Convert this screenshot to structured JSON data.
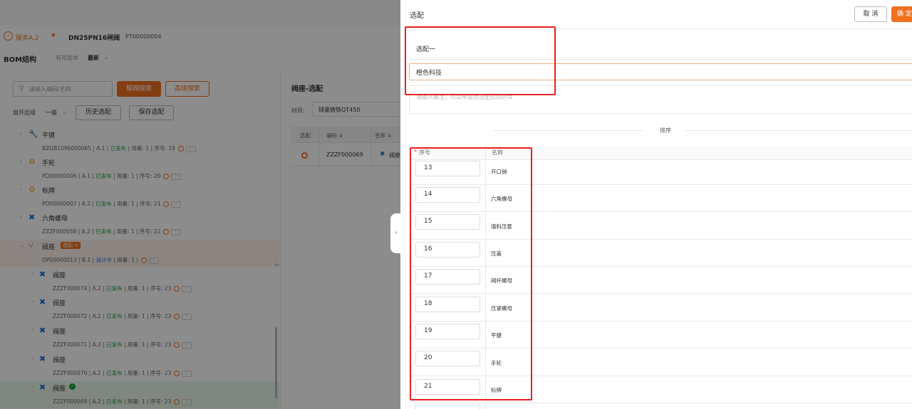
{
  "header": {
    "version_tag": "版本A.2",
    "part_name": "DN25PN16闸阀",
    "part_code": "PT00000004",
    "bom_title": "BOM结构",
    "effective_label": "有效版本",
    "effective_value": "最新"
  },
  "left_panel": {
    "search_placeholder": "请输入编码/名称",
    "fuzzy_search": "模糊搜索",
    "advanced_search": "高级搜索",
    "expand_label": "展开层级",
    "expand_value": "一级",
    "history_select": "历史选配",
    "save_select": "保存选配",
    "tree": [
      {
        "name": "平键",
        "meta_a": "BZGB1096000065 | A.1 |",
        "status": "已发布",
        "meta_b": "| 用量: 1 | 序号: 19",
        "icon": "wrench-icon"
      },
      {
        "name": "手轮",
        "meta_a": "PD00000006 | A.1 |",
        "status": "已发布",
        "meta_b": "| 用量: 1 | 序号: 20",
        "icon": "gear-icon"
      },
      {
        "name": "标牌",
        "meta_a": "PD00000007 | A.2 |",
        "status": "已发布",
        "meta_b": "| 用量: 1 | 序号: 21",
        "icon": "gear-icon"
      },
      {
        "name": "六角螺母",
        "meta_a": "ZZZF000058 | A.2 |",
        "status": "已发布",
        "meta_b": "| 用量: 1 | 序号: 22",
        "icon": "cross-icon"
      },
      {
        "name": "阀座",
        "badge": "选配 >",
        "meta_a": "OP00000013 | B.1 |",
        "status": "设计中",
        "meta_b": "| 用量: 1 |",
        "icon": "option-icon"
      },
      {
        "name": "阀座",
        "meta_a": "ZZZF000074 | A.2 |",
        "status": "已发布",
        "meta_b": "| 用量: 1 | 序号: 23",
        "icon": "cross-icon"
      },
      {
        "name": "阀座",
        "meta_a": "ZZZF000072 | A.2 |",
        "status": "已发布",
        "meta_b": "| 用量: 1 | 序号: 23",
        "icon": "cross-icon"
      },
      {
        "name": "阀座",
        "meta_a": "ZZZF000071 | A.2 |",
        "status": "已发布",
        "meta_b": "| 用量: 1 | 序号: 23",
        "icon": "cross-icon"
      },
      {
        "name": "阀座",
        "meta_a": "ZZZF000070 | A.2 |",
        "status": "已发布",
        "meta_b": "| 用量: 1 | 序号: 23",
        "icon": "cross-icon"
      },
      {
        "name": "阀座",
        "meta_a": "ZZZF000069 | A.2 |",
        "status": "已发布",
        "meta_b": "| 用量: 1 | 序号: 23",
        "icon": "cross-icon"
      }
    ]
  },
  "middle_panel": {
    "title": "阀座-选配",
    "material_label": "材质:",
    "material_value": "球墨铸铁QT450",
    "col_select": "选配",
    "col_code": "编码 ≑",
    "col_name": "名称 ≑",
    "row_code": "ZZZF000069",
    "row_name_prefix": "阀座"
  },
  "drawer": {
    "title": "选配",
    "cancel": "取 消",
    "confirm": "确 定",
    "config_name": "选配一",
    "company_input": "橙色科技",
    "remark_placeholder": "请输入备注，可简单描述选配的目的等",
    "sort_label": "排序",
    "col_no": "序号",
    "col_no_required": "*",
    "col_name": "名称",
    "rows": [
      {
        "no": "13",
        "name": "开口销"
      },
      {
        "no": "14",
        "name": "六角螺母"
      },
      {
        "no": "15",
        "name": "填料压套"
      },
      {
        "no": "16",
        "name": "压盖"
      },
      {
        "no": "17",
        "name": "阀杆螺母"
      },
      {
        "no": "18",
        "name": "压紧螺母"
      },
      {
        "no": "19",
        "name": "平键"
      },
      {
        "no": "20",
        "name": "手轮"
      },
      {
        "no": "21",
        "name": "标牌"
      }
    ]
  },
  "colors": {
    "accent": "#f0701e",
    "red_box": "#e81f1f",
    "published": "#1a9f3a",
    "designing": "#1e6fd9"
  }
}
